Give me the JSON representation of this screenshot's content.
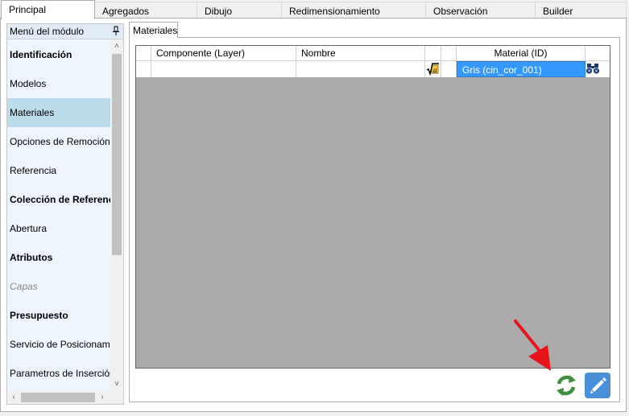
{
  "tabs": [
    {
      "label": "Principal",
      "active": true
    },
    {
      "label": "Agregados",
      "active": false
    },
    {
      "label": "Dibujo",
      "active": false
    },
    {
      "label": "Redimensionamiento",
      "active": false
    },
    {
      "label": "Observación",
      "active": false
    },
    {
      "label": "Builder",
      "active": false
    }
  ],
  "menu": {
    "header": "Menú del módulo",
    "items": [
      {
        "label": "Identificación",
        "style": "bold"
      },
      {
        "label": "Modelos",
        "style": "normal"
      },
      {
        "label": "Materiales",
        "style": "selected"
      },
      {
        "label": "Opciones de Remoción",
        "style": "normal"
      },
      {
        "label": "Referencia",
        "style": "normal"
      },
      {
        "label": "Colección de Referencia",
        "style": "bold"
      },
      {
        "label": "Abertura",
        "style": "normal"
      },
      {
        "label": "Atributos",
        "style": "bold"
      },
      {
        "label": "Capas",
        "style": "disabled"
      },
      {
        "label": "Presupuesto",
        "style": "bold"
      },
      {
        "label": "Servicio de Posicionamiento",
        "style": "normal"
      },
      {
        "label": "Parametros de Inserción",
        "style": "normal"
      }
    ]
  },
  "subtab": {
    "label": "Materiales"
  },
  "grid": {
    "columns": [
      "",
      "Componente (Layer)",
      "Nombre",
      "",
      "",
      "Material (ID)",
      ""
    ],
    "rows": [
      {
        "component": "",
        "name": "",
        "material": "Gris (cin_cor_001)"
      }
    ]
  },
  "icons": {
    "pin": "pin-icon",
    "formula": "formula-icon",
    "binoculars": "binoculars-icon",
    "refresh": "refresh-icon",
    "edit": "pencil-icon",
    "annotation_arrow": "red-arrow-annotation"
  },
  "colors": {
    "selected_cell": "#3399ff",
    "menu_selected": "#bcdcec",
    "grid_background": "#ababab",
    "refresh_green": "#3f8f3f",
    "edit_blue": "#4a90d9",
    "annotation_red": "#e8141b"
  }
}
